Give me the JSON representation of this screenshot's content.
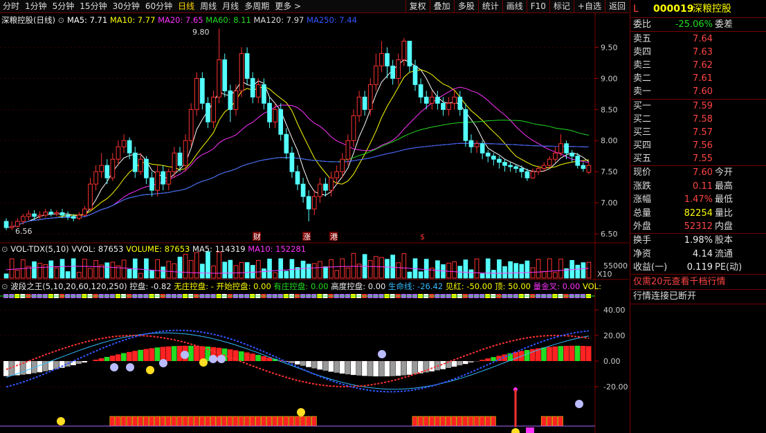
{
  "toolbar": {
    "periods": [
      "分时",
      "1分钟",
      "5分钟",
      "15分钟",
      "30分钟",
      "60分钟",
      "日线",
      "周线",
      "月线",
      "多周期",
      "更多 >"
    ],
    "active_index": 6,
    "buttons": [
      "复权",
      "叠加",
      "多股",
      "统计",
      "画线",
      "F10",
      "标记",
      "+自选",
      "返回"
    ]
  },
  "main_legend": {
    "title": "深粮控股(日线)",
    "ma5": "MA5: 7.71",
    "ma10": "MA10: 7.77",
    "ma20": "MA20: 7.65",
    "ma60": "MA60: 8.11",
    "ma120": "MA120: 7.97",
    "ma250": "MA250: 7.44"
  },
  "price_labels": {
    "high": "9.80",
    "low": "6.56"
  },
  "price_axis": [
    "9.50",
    "9.00",
    "8.50",
    "8.00",
    "7.50",
    "7.00",
    "6.50"
  ],
  "event_markers": [
    "财",
    "涨",
    "港",
    "$"
  ],
  "vol_legend": {
    "title": "VOL-TDX(5,10)",
    "vvol": "VVOL: 87653",
    "volume": "VOLUME: 87653",
    "ma5": "MA5: 114319",
    "ma10": "MA10: 152281"
  },
  "vol_axis": {
    "label": "55000",
    "unit": "X10"
  },
  "ind_legend": {
    "title": "波段之王(5,10,20,60,120,250)",
    "kp": "控盘: -0.82",
    "wz": "无庄控盘: -",
    "ks": "开始控盘: 0.00",
    "yz": "有庄控盘: 0.00",
    "gd": "高度控盘: 0.00",
    "smx": "生命线: -26.42",
    "jh": "见红: -50.00",
    "ding": "顶: 50.00",
    "hjc": "量金叉: 0.00",
    "vol": "VOL:"
  },
  "ind_axis": [
    "40.00",
    "20.00",
    "0.00",
    "-20.00"
  ],
  "quote": {
    "code": "000019",
    "name": "深粮控股",
    "prefix": "L",
    "weibi_label": "委比",
    "weibi": "-25.06%",
    "weicha_label": "委差",
    "asks": [
      {
        "label": "卖五",
        "price": "7.64"
      },
      {
        "label": "卖四",
        "price": "7.63"
      },
      {
        "label": "卖三",
        "price": "7.62"
      },
      {
        "label": "卖二",
        "price": "7.61"
      },
      {
        "label": "卖一",
        "price": "7.60"
      }
    ],
    "bids": [
      {
        "label": "买一",
        "price": "7.59"
      },
      {
        "label": "买二",
        "price": "7.58"
      },
      {
        "label": "买三",
        "price": "7.57"
      },
      {
        "label": "买四",
        "price": "7.56"
      },
      {
        "label": "买五",
        "price": "7.55"
      }
    ],
    "stats": [
      {
        "l1": "现价",
        "v": "7.60",
        "l2": "今开",
        "c": "red"
      },
      {
        "l1": "涨跌",
        "v": "0.11",
        "l2": "最高",
        "c": "red"
      },
      {
        "l1": "涨幅",
        "v": "1.47%",
        "l2": "最低",
        "c": "red"
      },
      {
        "l1": "总量",
        "v": "82254",
        "l2": "量比",
        "c": "yellow"
      },
      {
        "l1": "外盘",
        "v": "52312",
        "l2": "内盘",
        "c": "red"
      }
    ],
    "stats2": [
      {
        "l1": "换手",
        "v": "1.98%",
        "l2": "股本"
      },
      {
        "l1": "净资",
        "v": "4.14",
        "l2": "流通"
      },
      {
        "l1": "收益(一)",
        "v": "0.119",
        "l2": "PE(动)"
      }
    ],
    "promo": "仅需20元查看千档行情",
    "status": "行情连接已断开"
  },
  "chart_data": {
    "type": "candlestick",
    "price_range": [
      6.4,
      9.85
    ],
    "candles": [
      [
        6.7,
        6.6,
        6.75,
        6.56
      ],
      [
        6.6,
        6.62,
        6.7,
        6.56
      ],
      [
        6.62,
        6.7,
        6.75,
        6.6
      ],
      [
        6.7,
        6.78,
        6.82,
        6.65
      ],
      [
        6.78,
        6.82,
        6.88,
        6.72
      ],
      [
        6.82,
        6.78,
        6.88,
        6.72
      ],
      [
        6.78,
        6.8,
        6.86,
        6.74
      ],
      [
        6.8,
        6.85,
        6.9,
        6.76
      ],
      [
        6.85,
        6.82,
        6.9,
        6.78
      ],
      [
        6.82,
        6.84,
        6.88,
        6.78
      ],
      [
        6.84,
        6.8,
        6.9,
        6.75
      ],
      [
        6.8,
        6.78,
        6.86,
        6.72
      ],
      [
        6.78,
        6.75,
        6.82,
        6.7
      ],
      [
        6.75,
        6.8,
        6.85,
        6.72
      ],
      [
        6.8,
        6.9,
        6.95,
        6.78
      ],
      [
        6.9,
        7.3,
        7.4,
        6.88
      ],
      [
        7.3,
        7.5,
        7.6,
        7.2
      ],
      [
        7.5,
        7.6,
        7.8,
        7.4
      ],
      [
        7.6,
        7.4,
        7.7,
        7.3
      ],
      [
        7.4,
        7.7,
        7.8,
        7.35
      ],
      [
        7.7,
        7.9,
        8.0,
        7.6
      ],
      [
        7.9,
        8.0,
        8.1,
        7.8
      ],
      [
        8.0,
        7.8,
        8.05,
        7.7
      ],
      [
        7.8,
        7.5,
        7.9,
        7.4
      ],
      [
        7.5,
        7.7,
        7.8,
        7.45
      ],
      [
        7.7,
        7.4,
        7.75,
        7.3
      ],
      [
        7.4,
        7.2,
        7.5,
        7.1
      ],
      [
        7.2,
        7.5,
        7.6,
        7.1
      ],
      [
        7.5,
        7.3,
        7.6,
        7.2
      ],
      [
        7.3,
        7.5,
        7.55,
        7.2
      ],
      [
        7.5,
        7.8,
        7.9,
        7.4
      ],
      [
        7.8,
        7.6,
        7.9,
        7.5
      ],
      [
        7.6,
        8.0,
        8.1,
        7.5
      ],
      [
        8.0,
        8.5,
        8.6,
        7.9
      ],
      [
        8.5,
        9.0,
        9.1,
        8.4
      ],
      [
        9.0,
        8.6,
        9.1,
        8.5
      ],
      [
        8.6,
        8.3,
        8.7,
        8.2
      ],
      [
        8.3,
        8.7,
        8.8,
        8.2
      ],
      [
        8.7,
        9.3,
        9.8,
        8.6
      ],
      [
        9.3,
        8.8,
        9.4,
        8.7
      ],
      [
        8.8,
        8.5,
        8.9,
        8.3
      ],
      [
        8.5,
        8.8,
        8.9,
        8.4
      ],
      [
        8.8,
        9.4,
        9.5,
        8.7
      ],
      [
        9.4,
        9.0,
        9.5,
        8.9
      ],
      [
        9.0,
        8.7,
        9.1,
        8.6
      ],
      [
        8.7,
        8.9,
        9.0,
        8.6
      ],
      [
        8.9,
        8.6,
        9.0,
        8.5
      ],
      [
        8.6,
        8.3,
        8.7,
        8.2
      ],
      [
        8.3,
        8.5,
        8.6,
        8.2
      ],
      [
        8.5,
        8.1,
        8.6,
        8.0
      ],
      [
        8.1,
        7.8,
        8.2,
        7.7
      ],
      [
        7.8,
        7.5,
        7.9,
        7.4
      ],
      [
        7.5,
        7.3,
        7.6,
        7.2
      ],
      [
        7.3,
        7.1,
        7.4,
        7.0
      ],
      [
        7.1,
        6.9,
        7.2,
        6.7
      ],
      [
        6.9,
        7.1,
        7.2,
        6.8
      ],
      [
        7.1,
        7.3,
        7.4,
        7.0
      ],
      [
        7.3,
        7.2,
        7.4,
        7.1
      ],
      [
        7.2,
        7.4,
        7.5,
        7.1
      ],
      [
        7.4,
        7.5,
        7.6,
        7.3
      ],
      [
        7.5,
        7.7,
        7.8,
        7.4
      ],
      [
        7.7,
        8.0,
        8.1,
        7.6
      ],
      [
        8.0,
        8.4,
        8.5,
        7.9
      ],
      [
        8.4,
        8.7,
        8.8,
        8.3
      ],
      [
        8.7,
        8.5,
        8.8,
        8.4
      ],
      [
        8.5,
        8.9,
        9.0,
        8.4
      ],
      [
        8.9,
        9.2,
        9.4,
        8.8
      ],
      [
        9.2,
        9.4,
        9.6,
        9.1
      ],
      [
        9.4,
        9.2,
        9.5,
        9.0
      ],
      [
        9.2,
        9.0,
        9.3,
        8.9
      ],
      [
        9.0,
        9.3,
        9.4,
        8.9
      ],
      [
        9.3,
        9.6,
        9.65,
        9.2
      ],
      [
        9.6,
        9.2,
        9.6,
        9.1
      ],
      [
        9.2,
        8.9,
        9.3,
        8.8
      ],
      [
        8.9,
        8.7,
        9.0,
        8.6
      ],
      [
        8.7,
        8.6,
        8.8,
        8.5
      ],
      [
        8.6,
        8.7,
        8.8,
        8.5
      ],
      [
        8.7,
        8.6,
        8.8,
        8.5
      ],
      [
        8.6,
        8.5,
        8.7,
        8.4
      ],
      [
        8.5,
        8.6,
        8.7,
        8.4
      ],
      [
        8.6,
        8.7,
        8.8,
        8.5
      ],
      [
        8.7,
        8.5,
        8.8,
        8.4
      ],
      [
        8.5,
        8.0,
        8.6,
        7.9
      ],
      [
        8.0,
        7.9,
        8.1,
        7.8
      ],
      [
        7.9,
        7.95,
        8.0,
        7.8
      ],
      [
        7.95,
        7.8,
        8.0,
        7.7
      ],
      [
        7.8,
        7.75,
        7.85,
        7.65
      ],
      [
        7.75,
        7.7,
        7.8,
        7.6
      ],
      [
        7.7,
        7.65,
        7.75,
        7.55
      ],
      [
        7.65,
        7.6,
        7.7,
        7.5
      ],
      [
        7.6,
        7.58,
        7.65,
        7.5
      ],
      [
        7.58,
        7.55,
        7.62,
        7.48
      ],
      [
        7.55,
        7.5,
        7.6,
        7.4
      ],
      [
        7.5,
        7.4,
        7.55,
        7.35
      ],
      [
        7.4,
        7.5,
        7.55,
        7.38
      ],
      [
        7.5,
        7.55,
        7.6,
        7.45
      ],
      [
        7.55,
        7.6,
        7.65,
        7.5
      ],
      [
        7.6,
        7.7,
        7.75,
        7.55
      ],
      [
        7.7,
        7.8,
        7.9,
        7.65
      ],
      [
        7.8,
        7.95,
        8.1,
        7.75
      ],
      [
        7.95,
        7.8,
        8.0,
        7.7
      ],
      [
        7.8,
        7.75,
        7.85,
        7.65
      ],
      [
        7.75,
        7.6,
        7.8,
        7.55
      ],
      [
        7.6,
        7.55,
        7.65,
        7.5
      ],
      [
        7.49,
        7.6,
        7.64,
        7.46
      ]
    ],
    "ma_colors": {
      "ma5": "#ffffff",
      "ma10": "#ffff00",
      "ma20": "#ff33ff",
      "ma60": "#22dd22",
      "ma120": "#dddddd",
      "ma250": "#3355ff"
    }
  }
}
